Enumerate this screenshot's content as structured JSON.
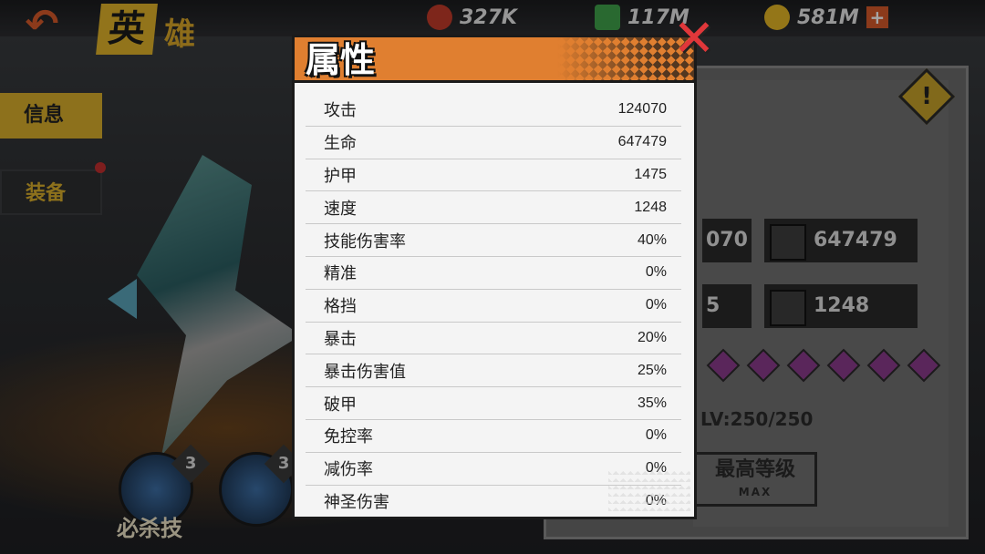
{
  "header": {
    "back_icon": "back-arrow-icon",
    "title_part1": "英",
    "title_part2": "雄",
    "resources": [
      {
        "icon": "meat-icon",
        "value": "327K"
      },
      {
        "icon": "potion-icon",
        "value": "117M"
      },
      {
        "icon": "gold-coin-icon",
        "value": "581M"
      }
    ],
    "plus_label": "+"
  },
  "side_tabs": [
    {
      "label": "信息",
      "active": true
    },
    {
      "label": "装备",
      "active": false
    }
  ],
  "skills": [
    {
      "badge": "3"
    },
    {
      "badge": "3"
    }
  ],
  "skill_label": "必杀技",
  "right_panel": {
    "stat_hp_value": "647479",
    "stat_speed_value": "1248",
    "stat_left1_value": "070",
    "stat_left2_value": "5",
    "level_text": "LV:250/250",
    "max_button_label": "最高等级",
    "max_button_sub": "MAX"
  },
  "modal": {
    "title": "属性",
    "close_icon": "close-x-icon",
    "stats": [
      {
        "name": "攻击",
        "value": "124070"
      },
      {
        "name": "生命",
        "value": "647479"
      },
      {
        "name": "护甲",
        "value": "1475"
      },
      {
        "name": "速度",
        "value": "1248"
      },
      {
        "name": "技能伤害率",
        "value": "40%"
      },
      {
        "name": "精准",
        "value": "0%"
      },
      {
        "name": "格挡",
        "value": "0%"
      },
      {
        "name": "暴击",
        "value": "20%"
      },
      {
        "name": "暴击伤害值",
        "value": "25%"
      },
      {
        "name": "破甲",
        "value": "35%"
      },
      {
        "name": "免控率",
        "value": "0%"
      },
      {
        "name": "减伤率",
        "value": "0%"
      },
      {
        "name": "神圣伤害",
        "value": "0%"
      }
    ]
  },
  "colors": {
    "header_orange": "#e07f30",
    "close_red": "#e0373a",
    "tab_gold": "#d9ae2c"
  }
}
